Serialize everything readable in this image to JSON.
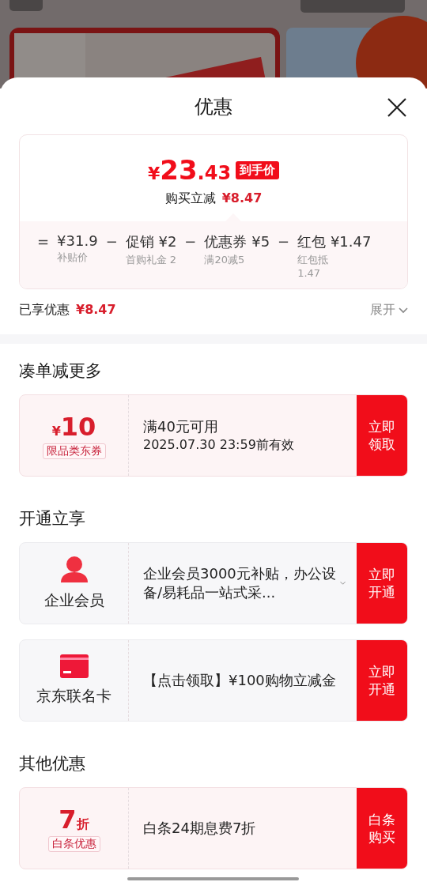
{
  "sheet": {
    "title": "优惠"
  },
  "price_card": {
    "currency": "¥",
    "integer": "23",
    "decimal": ".43",
    "badge": "到手价",
    "savings_label": "购买立减",
    "savings_amount": "¥8.47",
    "breakdown": [
      {
        "sign": "=",
        "value": "¥31.9",
        "note": "补贴价"
      },
      {
        "sign": "−",
        "value": "促销 ¥2",
        "note": "首购礼金 2"
      },
      {
        "sign": "−",
        "value": "优惠券 ¥5",
        "note": "满20减5"
      },
      {
        "sign": "−",
        "value": "红包 ¥1.47",
        "note": "红包抵1.47"
      }
    ]
  },
  "enjoyed": {
    "label": "已享优惠",
    "amount": "¥8.47",
    "toggle": "展开",
    "expanded": false
  },
  "sections": [
    {
      "title": "凑单减更多",
      "offers": [
        {
          "kind": "coupon",
          "prefix": "¥",
          "value": "10",
          "tag": "限品类东券",
          "lines": [
            "满40元可用",
            "2025.07.30 23:59前有效"
          ],
          "expandable": false,
          "action": "立即领取"
        }
      ]
    },
    {
      "title": "开通立享",
      "offers": [
        {
          "kind": "membership",
          "name": "企业会员",
          "lines": [
            "企业会员3000元补贴，办公设备/易耗品一站式采..."
          ],
          "expandable": true,
          "action": "立即开通"
        },
        {
          "kind": "cobrand_card",
          "name": "京东联名卡",
          "lines": [
            "【点击领取】¥100购物立减金"
          ],
          "expandable": false,
          "action": "立即开通"
        }
      ]
    },
    {
      "title": "其他优惠",
      "offers": [
        {
          "kind": "coupon",
          "value": "7",
          "suffix": "折",
          "tag": "白条优惠",
          "lines": [
            "白条24期息费7折"
          ],
          "expandable": false,
          "action": "白条购买"
        }
      ]
    }
  ]
}
